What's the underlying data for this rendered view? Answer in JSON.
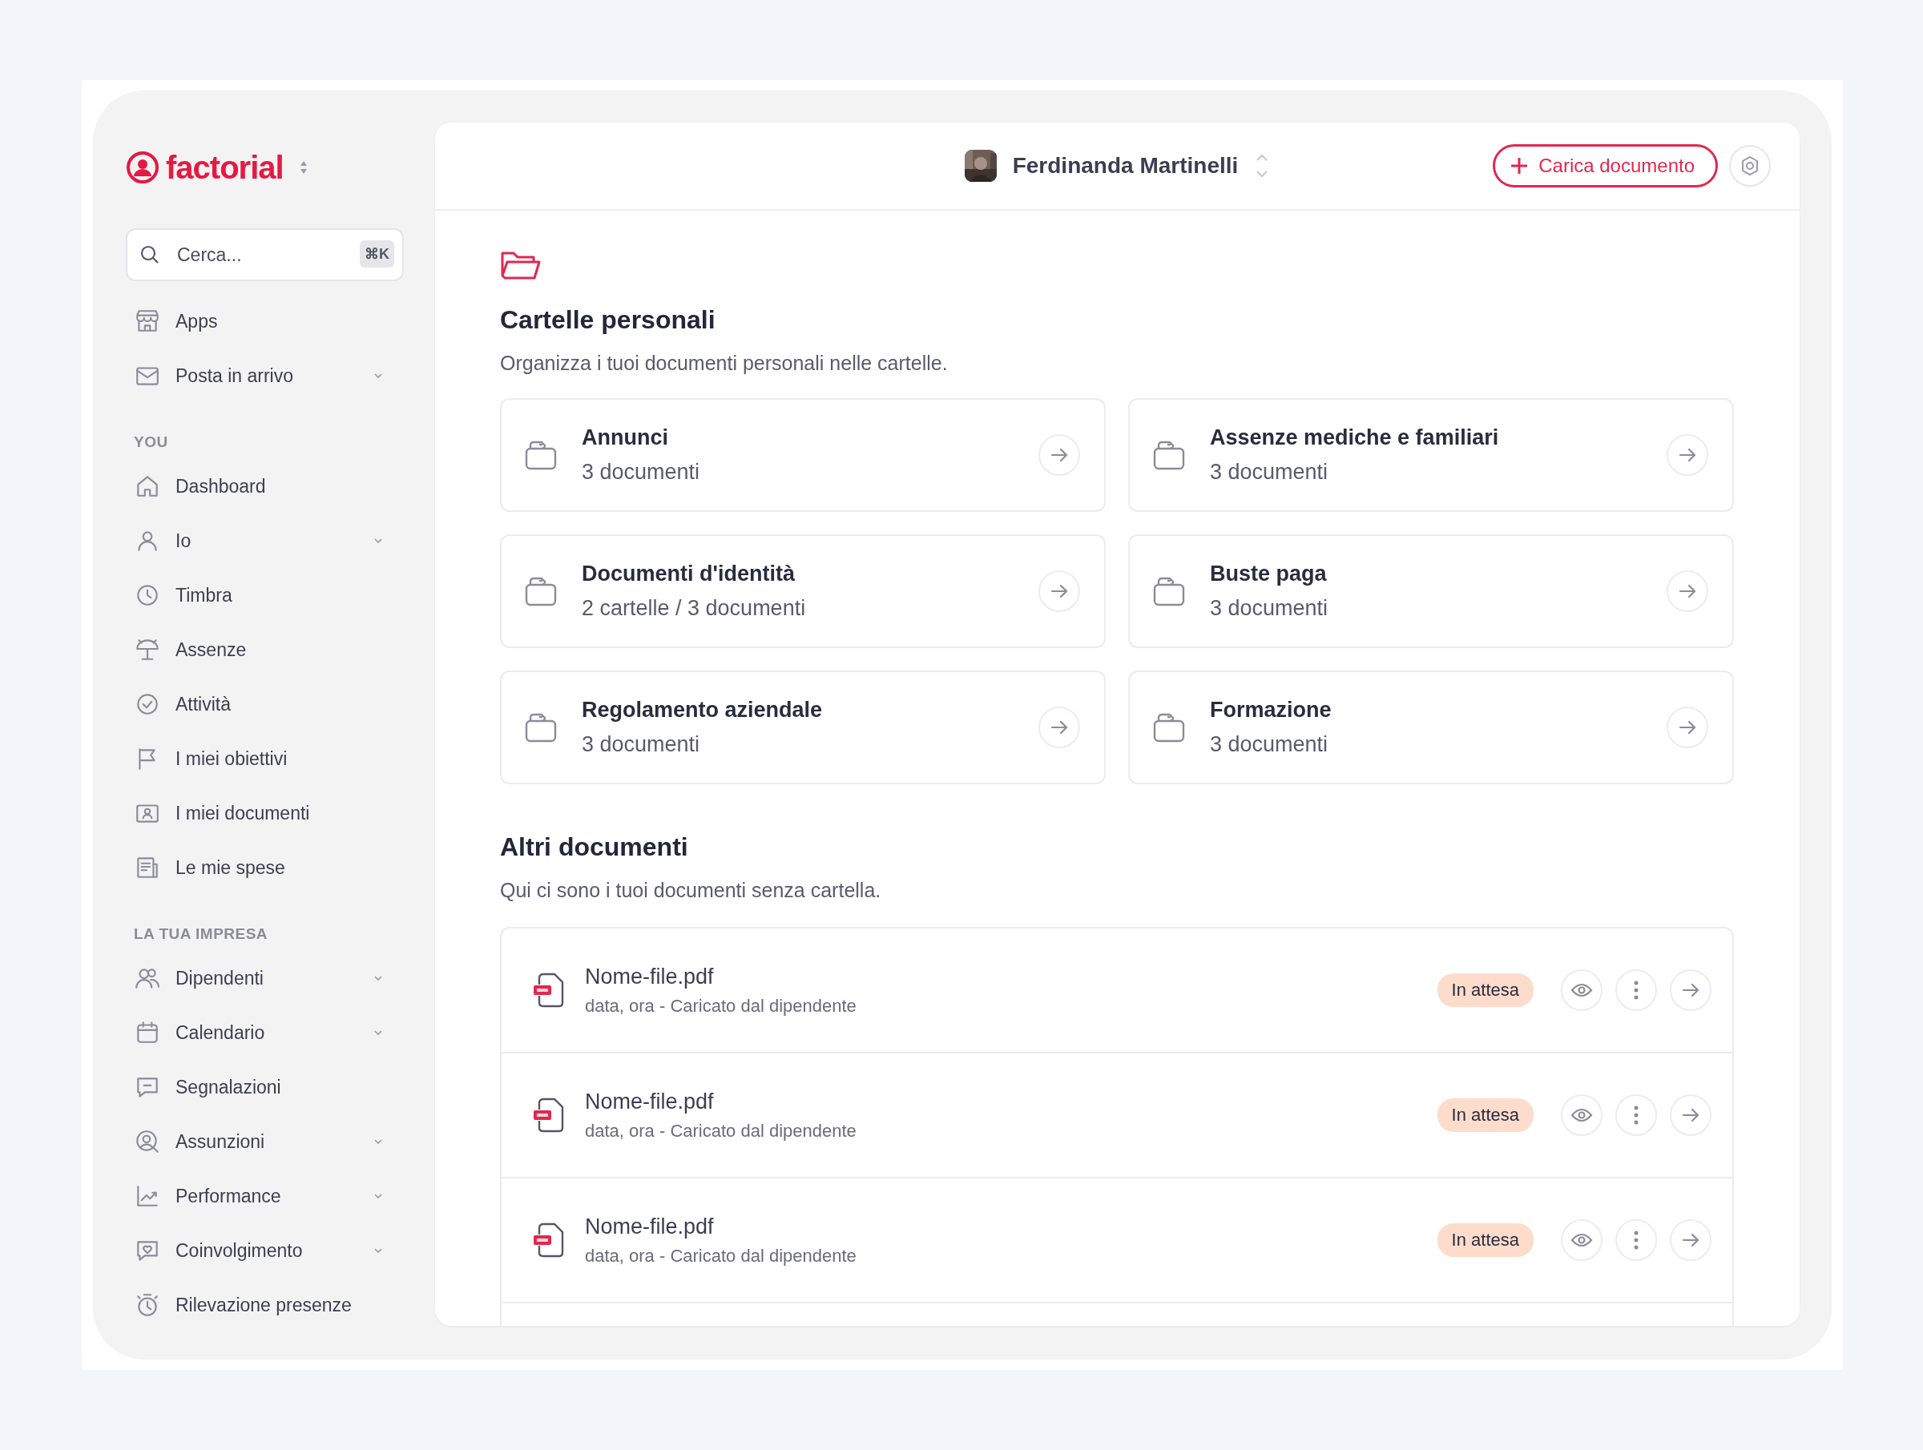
{
  "brand": {
    "name": "factorial"
  },
  "search": {
    "placeholder": "Cerca...",
    "shortcut": "⌘K"
  },
  "nav_top": [
    {
      "label": "Apps",
      "expandable": false
    },
    {
      "label": "Posta in arrivo",
      "expandable": true
    }
  ],
  "sections": [
    {
      "title": "YOU",
      "items": [
        {
          "label": "Dashboard",
          "expandable": false
        },
        {
          "label": "Io",
          "expandable": true
        },
        {
          "label": "Timbra",
          "expandable": false
        },
        {
          "label": "Assenze",
          "expandable": false
        },
        {
          "label": "Attività",
          "expandable": false
        },
        {
          "label": "I miei obiettivi",
          "expandable": false
        },
        {
          "label": "I miei documenti",
          "expandable": false
        },
        {
          "label": "Le mie spese",
          "expandable": false
        }
      ]
    },
    {
      "title": "LA TUA IMPRESA",
      "items": [
        {
          "label": "Dipendenti",
          "expandable": true
        },
        {
          "label": "Calendario",
          "expandable": true
        },
        {
          "label": "Segnalazioni",
          "expandable": false
        },
        {
          "label": "Assunzioni",
          "expandable": true
        },
        {
          "label": "Performance",
          "expandable": true
        },
        {
          "label": "Coinvolgimento",
          "expandable": true
        },
        {
          "label": "Rilevazione presenze",
          "expandable": false
        }
      ]
    }
  ],
  "header": {
    "user": "Ferdinanda Martinelli",
    "upload_button": "Carica documento"
  },
  "folders": {
    "title": "Cartelle personali",
    "subtitle": "Organizza i tuoi documenti personali nelle cartelle.",
    "items": [
      {
        "name": "Annunci",
        "count": "3 documenti"
      },
      {
        "name": "Assenze mediche e familiari",
        "count": "3 documenti"
      },
      {
        "name": "Documenti d'identità",
        "count": "2 cartelle / 3 documenti"
      },
      {
        "name": "Buste paga",
        "count": "3 documenti"
      },
      {
        "name": "Regolamento aziendale",
        "count": "3 documenti"
      },
      {
        "name": "Formazione",
        "count": "3 documenti"
      }
    ]
  },
  "documents": {
    "title": "Altri documenti",
    "subtitle": "Qui ci sono i tuoi documenti senza cartella.",
    "items": [
      {
        "name": "Nome-file.pdf",
        "meta": "data, ora - Caricato dal dipendente",
        "status": "In attesa"
      },
      {
        "name": "Nome-file.pdf",
        "meta": "data, ora - Caricato dal dipendente",
        "status": "In attesa"
      },
      {
        "name": "Nome-file.pdf",
        "meta": "data, ora - Caricato dal dipendente",
        "status": "In attesa"
      }
    ]
  }
}
